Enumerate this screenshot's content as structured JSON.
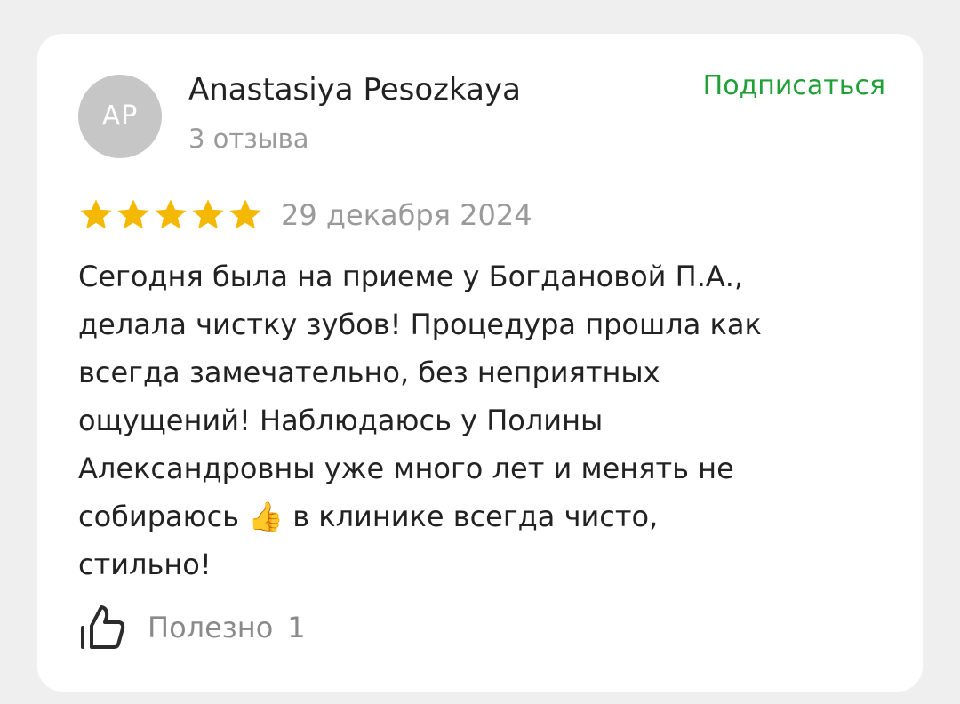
{
  "review": {
    "author": {
      "initials": "AP",
      "name": "Anastasiya Pesozkaya",
      "reviews_count_text": "3 отзыва",
      "avatar_color": "#c6c6c6"
    },
    "subscribe_label": "Подписаться",
    "subscribe_color": "#21a038",
    "rating": 5,
    "max_rating": 5,
    "star_color": "#f5b800",
    "date": "29 декабря 2024",
    "text": "Сегодня была на приеме у Богдановой П.А.,\nделала чистку зубов! Процедура прошла как\nвсегда замечательно, без неприятных\nощущений! Наблюдаюсь у Полины\nАлександровны уже много лет и менять не\nсобираюсь 👍 в клинике всегда чисто,\nстильно!",
    "helpful": {
      "label": "Полезно",
      "count": "1",
      "icon": "thumbs-up-icon"
    }
  }
}
